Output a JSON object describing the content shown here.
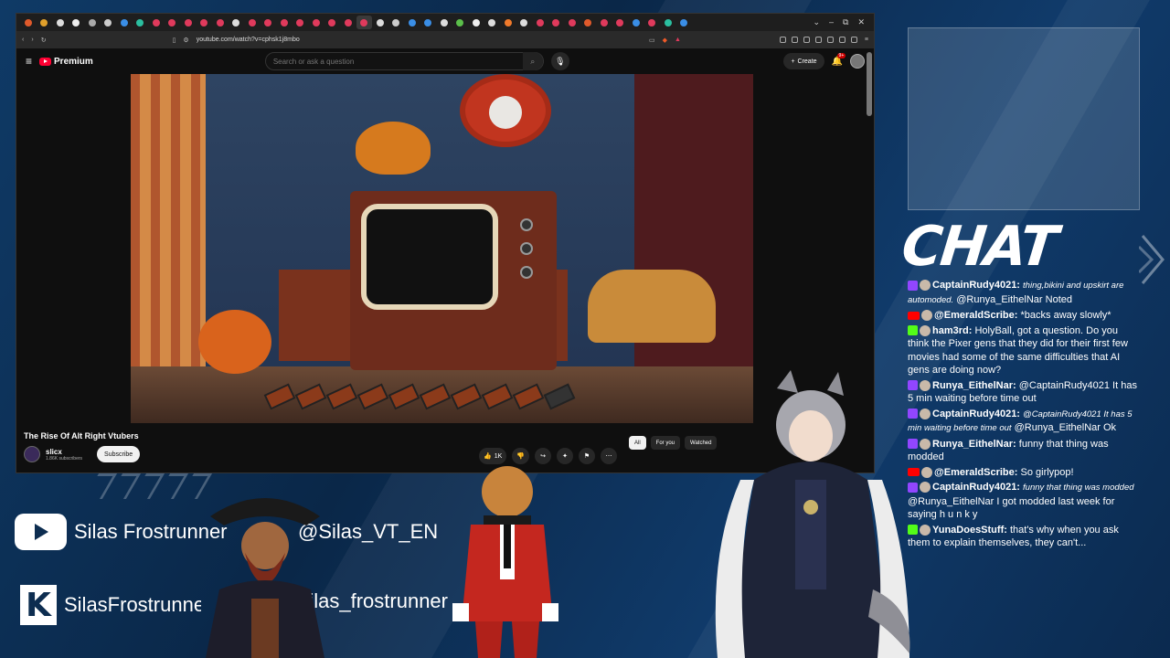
{
  "browser": {
    "url": "youtube.com/watch?v=cphsk1j8mbo",
    "tab_colors": [
      "#e05a2b",
      "#e0a02b",
      "#ddd",
      "#eee",
      "#aaa",
      "#ccc",
      "#3a8ee6",
      "#2bbfa0",
      "#e03a5c",
      "#e03a5c",
      "#e03a5c",
      "#e03a5c",
      "#e03a5c",
      "#ddd",
      "#e03a5c",
      "#e03a5c",
      "#e03a5c",
      "#e03a5c",
      "#e03a5c",
      "#e03a5c",
      "#e03a5c",
      "#e03a5c",
      "#ddd",
      "#ccc",
      "#3a8ee6",
      "#3a8ee6",
      "#ddd",
      "#5bbf4a",
      "#eee",
      "#ddd",
      "#f07a2b",
      "#ddd",
      "#e03a5c",
      "#e03a5c",
      "#e03a5c",
      "#e05a2b",
      "#e03a5c",
      "#e03a5c",
      "#3a8ee6",
      "#e03a5c",
      "#2bbfa0",
      "#3a8ee6"
    ],
    "win_controls": [
      "⌄",
      "–",
      "⧉",
      "✕"
    ]
  },
  "youtube": {
    "brand": "Premium",
    "search_placeholder": "Search or ask a question",
    "create_label": "Create",
    "notif_count": "9+",
    "video_title": "The Rise Of Alt Right Vtubers",
    "channel_name": "slicx",
    "channel_subs": "1.86K subscribers",
    "subscribe_label": "Subscribe",
    "like_count": "1K",
    "chips": [
      "All",
      "For you",
      "Watched"
    ]
  },
  "overlay": {
    "chat_title": "CHAT",
    "youtube_handle": "Silas Frostrunner",
    "youtube_at": "@Silas_VT_EN",
    "kick_handle": "SilasFrostrunner",
    "kick_at": "Silas_frostrunner"
  },
  "chat": [
    {
      "platform": "twitch",
      "user": "CaptainRudy4021:",
      "italic": "thing,bikini and upskirt are automoded.",
      "text": "@Runya_EithelNar Noted"
    },
    {
      "platform": "youtube",
      "user": "@EmeraldScribe:",
      "italic": "",
      "text": "*backs away slowly*"
    },
    {
      "platform": "kick",
      "user": "ham3rd:",
      "italic": "",
      "text": "HolyBall, got a question. Do you think the Pixer gens that they did for their first few movies had some of the same difficulties that AI gens are doing now?"
    },
    {
      "platform": "twitch",
      "user": "Runya_EithelNar:",
      "italic": "",
      "text": "@CaptainRudy4021 It has 5 min waiting before time out"
    },
    {
      "platform": "twitch",
      "user": "CaptainRudy4021:",
      "italic": "@CaptainRudy4021 It has 5 min waiting before time out",
      "text": "@Runya_EithelNar Ok"
    },
    {
      "platform": "twitch",
      "user": "Runya_EithelNar:",
      "italic": "",
      "text": "funny that thing was modded"
    },
    {
      "platform": "youtube",
      "user": "@EmeraldScribe:",
      "italic": "",
      "text": "So girlypop!"
    },
    {
      "platform": "twitch",
      "user": "CaptainRudy4021:",
      "italic": "funny that thing was modded",
      "text": "@Runya_EithelNar I got modded last week for saying h u n k y"
    },
    {
      "platform": "kick",
      "user": "YunaDoesStuff:",
      "italic": "",
      "text": "that's why when you ask them to explain themselves, they can't..."
    }
  ]
}
